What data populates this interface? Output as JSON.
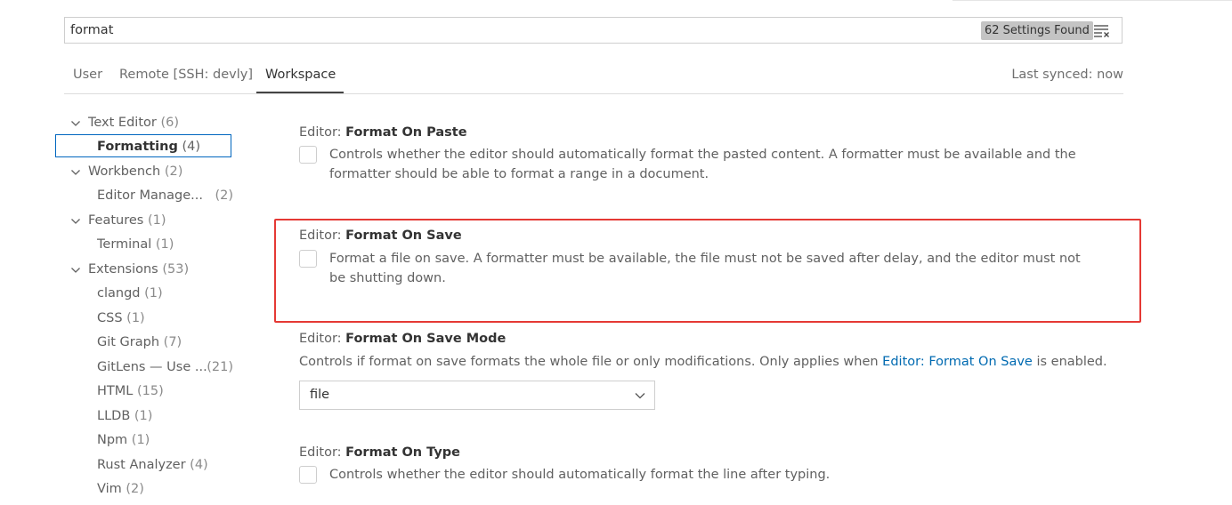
{
  "search": {
    "value": "format",
    "results_badge": "62 Settings Found"
  },
  "tabs": [
    {
      "label": "User"
    },
    {
      "label": "Remote [SSH: devly]"
    },
    {
      "label": "Workspace"
    }
  ],
  "sync_status": "Last synced: now",
  "toc": [
    {
      "label": "Text Editor",
      "count": "(6)",
      "expanded": true
    },
    {
      "label": "Formatting",
      "count": "(4)",
      "selected": true
    },
    {
      "label": "Workbench",
      "count": "(2)",
      "expanded": true
    },
    {
      "label": "Editor Manage...",
      "count": "(2)"
    },
    {
      "label": "Features",
      "count": "(1)",
      "expanded": true
    },
    {
      "label": "Terminal",
      "count": "(1)"
    },
    {
      "label": "Extensions",
      "count": "(53)",
      "expanded": true
    },
    {
      "label": "clangd",
      "count": "(1)"
    },
    {
      "label": "CSS",
      "count": "(1)"
    },
    {
      "label": "Git Graph",
      "count": "(7)"
    },
    {
      "label": "GitLens — Use ...",
      "count": "(21)"
    },
    {
      "label": "HTML",
      "count": "(15)"
    },
    {
      "label": "LLDB",
      "count": "(1)"
    },
    {
      "label": "Npm",
      "count": "(1)"
    },
    {
      "label": "Rust Analyzer",
      "count": "(4)"
    },
    {
      "label": "Vim",
      "count": "(2)"
    }
  ],
  "settings": {
    "format_on_paste": {
      "category": "Editor:",
      "name": "Format On Paste",
      "description": "Controls whether the editor should automatically format the pasted content. A formatter must be available and the formatter should be able to format a range in a document.",
      "checked": false
    },
    "format_on_save": {
      "category": "Editor:",
      "name": "Format On Save",
      "description": "Format a file on save. A formatter must be available, the file must not be saved after delay, and the editor must not be shutting down.",
      "checked": false
    },
    "format_on_save_mode": {
      "category": "Editor:",
      "name": "Format On Save Mode",
      "description_before": "Controls if format on save formats the whole file or only modifications. Only applies when",
      "description_link": "Editor: Format On Save",
      "description_after": "is enabled.",
      "value": "file"
    },
    "format_on_type": {
      "category": "Editor:",
      "name": "Format On Type",
      "description": "Controls whether the editor should automatically format the line after typing.",
      "checked": false
    }
  },
  "colors": {
    "selection_border": "#0066bf",
    "highlight_box": "#e53935",
    "link": "#006ab1"
  },
  "icons": {
    "clear_filter": "clear-filter-icon",
    "chevron": "chevron-down-icon"
  }
}
